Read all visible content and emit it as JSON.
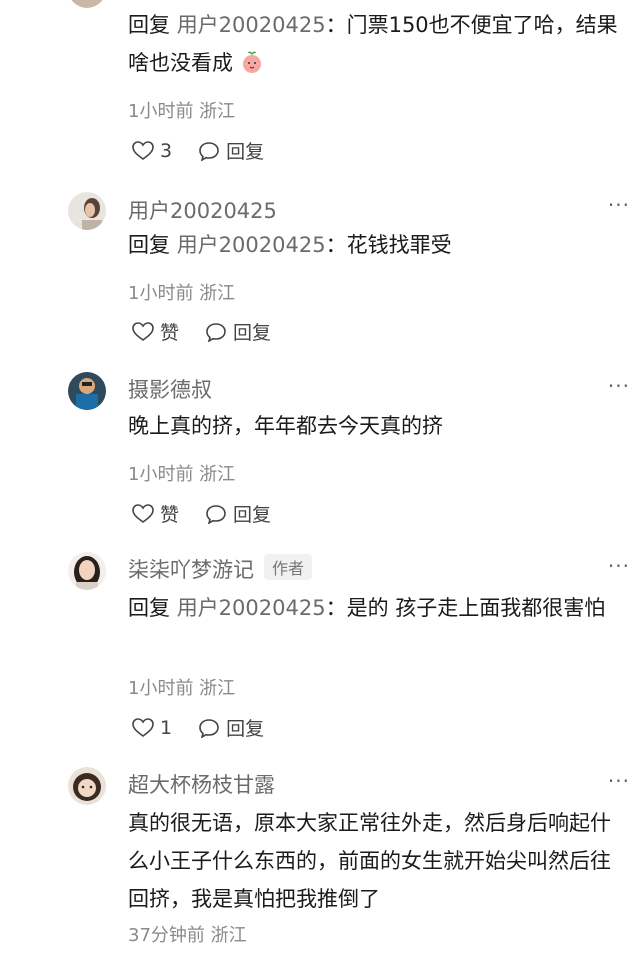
{
  "comments": [
    {
      "reply_prefix": "回复",
      "reply_to": "用户20020425",
      "text": "：门票150也不便宜了哈，结果啥也没看成",
      "emoji": "peach-face-emoji",
      "meta": "1小时前 浙江",
      "like_count": "3",
      "reply_label": "回复"
    },
    {
      "username": "用户20020425",
      "reply_prefix": "回复",
      "reply_to": "用户20020425",
      "text": "：花钱找罪受",
      "meta": "1小时前 浙江",
      "like_label": "赞",
      "reply_label": "回复",
      "more": "···"
    },
    {
      "username": "摄影德叔",
      "text": "晚上真的挤，年年都去今天真的挤",
      "meta": "1小时前 浙江",
      "like_label": "赞",
      "reply_label": "回复",
      "more": "···"
    },
    {
      "username": "柒柒吖梦游记",
      "badge": "作者",
      "reply_prefix": "回复",
      "reply_to": "用户20020425",
      "text": "：是的 孩子走上面我都很害怕",
      "meta": "1小时前 浙江",
      "like_count": "1",
      "reply_label": "回复",
      "more": "···"
    },
    {
      "username": "超大杯杨枝甘露",
      "text": "真的很无语，原本大家正常往外走，然后身后响起什么小王子什么东西的，前面的女生就开始尖叫然后往回挤，我是真怕把我推倒了",
      "meta": "37分钟前 浙江",
      "more": "···"
    }
  ]
}
